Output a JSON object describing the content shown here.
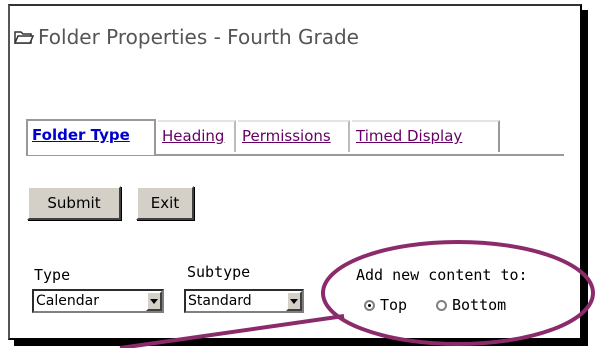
{
  "window": {
    "title": "Folder Properties - Fourth Grade",
    "icon": "folder-open-icon"
  },
  "tabs": [
    {
      "label": "Folder Type",
      "active": true
    },
    {
      "label": "Heading",
      "active": false
    },
    {
      "label": "Permissions",
      "active": false
    },
    {
      "label": "Timed Display",
      "active": false
    }
  ],
  "buttons": {
    "submit_label": "Submit",
    "exit_label": "Exit"
  },
  "type_field": {
    "label": "Type",
    "value": "Calendar"
  },
  "subtype_field": {
    "label": "Subtype",
    "value": "Standard"
  },
  "add_content": {
    "label": "Add new content to:",
    "options": [
      {
        "label": "Top",
        "checked": true
      },
      {
        "label": "Bottom",
        "checked": false
      }
    ]
  },
  "colors": {
    "active_tab": "#0000cc",
    "visited_link": "#660066",
    "annotation": "#8b2b6b"
  }
}
